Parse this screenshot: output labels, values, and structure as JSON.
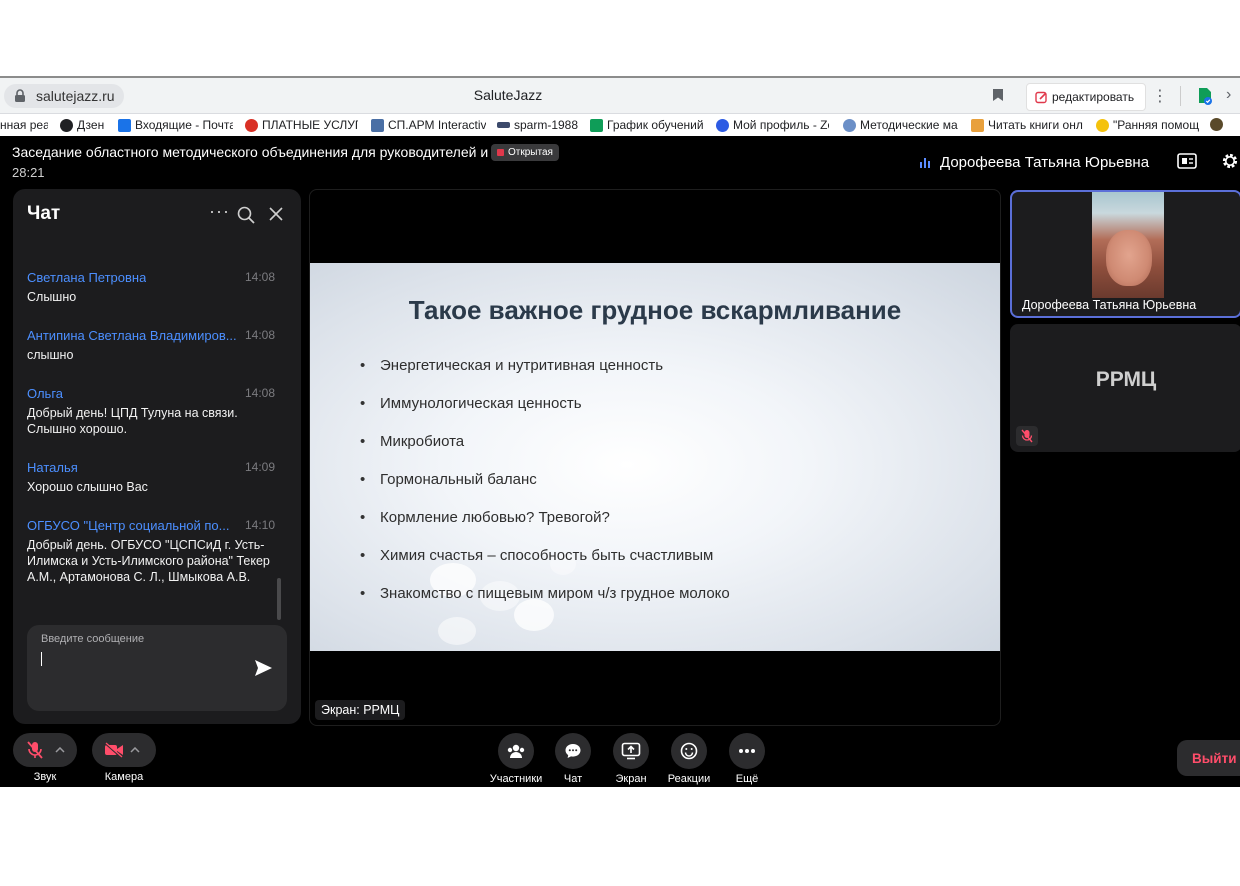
{
  "browser": {
    "url": "salutejazz.ru",
    "page_title": "SaluteJazz",
    "edit_label": "редактировать"
  },
  "bookmarks": [
    {
      "label": "нная реа",
      "color": "#4a90d9"
    },
    {
      "label": "Дзен",
      "color": "#202124"
    },
    {
      "label": "Входящие - Почта",
      "color": "#1a73e8"
    },
    {
      "label": "ПЛАТНЫЕ УСЛУГ",
      "color": "#d93025"
    },
    {
      "label": "СП.АРМ Interactiv",
      "color": "#4a6fa5"
    },
    {
      "label": "sparm-1988",
      "color": "#3c4a6b"
    },
    {
      "label": "График обучений",
      "color": "#0f9d58"
    },
    {
      "label": "Мой профиль - Zo",
      "color": "#2d5be3"
    },
    {
      "label": "Методические ма",
      "color": "#6b8fc7"
    },
    {
      "label": "Читать книги онл",
      "color": "#e8a03c"
    },
    {
      "label": "\"Ранняя помощ",
      "color": "#f4c20d"
    }
  ],
  "meeting": {
    "title": "Заседание областного методического объединения для руководителей и ...",
    "badge": "Открытая",
    "timer": "28:21",
    "speaker": "Дорофеева Татьяна Юрьевна"
  },
  "chat": {
    "title": "Чат",
    "input_placeholder": "Введите сообщение",
    "messages": [
      {
        "author": "Светлана Петровна",
        "time": "14:08",
        "text": "Слышно"
      },
      {
        "author": "Антипина Светлана Владимиров...",
        "time": "14:08",
        "text": "слышно"
      },
      {
        "author": "Ольга",
        "time": "14:08",
        "text": "Добрый день! ЦПД Тулуна на связи. Слышно хорошо."
      },
      {
        "author": "Наталья",
        "time": "14:09",
        "text": "Хорошо слышно Вас"
      },
      {
        "author": "ОГБУСО \"Центр социальной по...",
        "time": "14:10",
        "text": "Добрый день. ОГБУСО \"ЦСПСиД г. Усть-Илимска и Усть-Илимского района\" Текер А.М., Артамонова С. Л., Шмыкова А.В."
      }
    ]
  },
  "slide": {
    "title": "Такое важное грудное вскармливание",
    "bullets": [
      "Энергетическая и нутритивная ценность",
      "Иммунологическая ценность",
      "Микробиота",
      "Гормональный баланс",
      "Кормление любовью? Тревогой?",
      "Химия счастья – способность быть счастливым",
      "Знакомство с пищевым миром ч/з грудное молоко"
    ],
    "bullet_char": "•",
    "screen_label": "Экран: РРМЦ"
  },
  "participants": {
    "active_name": "Дорофеева Татьяна Юрьевна",
    "second_initials": "РРМЦ"
  },
  "controls": {
    "sound": "Звук",
    "camera": "Камера",
    "participants": "Участники",
    "chat": "Чат",
    "screen": "Экран",
    "reactions": "Реакции",
    "more": "Ещё",
    "exit": "Выйти"
  },
  "colors": {
    "accent_blue": "#4c8fff",
    "muted_red": "#ff4d6a",
    "active_border": "#5b6fd8"
  }
}
